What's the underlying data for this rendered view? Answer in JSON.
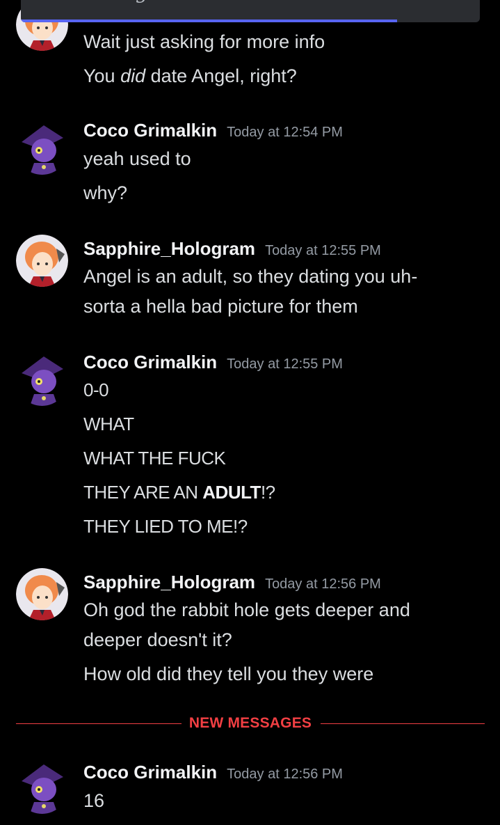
{
  "top_bar": {
    "text": "glare",
    "progress_fraction": 0.82
  },
  "colors": {
    "background": "#000000",
    "new_messages": "#f23f43",
    "accent": "#5865f2"
  },
  "groups": [
    {
      "avatar_icon": "sapphire-avatar-icon",
      "lines": [
        {
          "text": "Wait just asking for more info"
        }
      ]
    },
    {
      "lines": [
        {
          "pre": "You ",
          "em": "did",
          "post": " date Angel, right?"
        }
      ]
    },
    {
      "username": "Coco Grimalkin",
      "timestamp": "Today at 12:54 PM",
      "lines": [
        {
          "text": "yeah used to"
        },
        {
          "text": "why?"
        }
      ]
    },
    {
      "username": "Sapphire_Hologram",
      "timestamp": "Today at 12:55 PM",
      "lines": [
        {
          "text": "Angel is an adult, so they dating you uh-"
        },
        {
          "text": "sorta a hella bad picture for them"
        }
      ]
    },
    {
      "username": "Coco Grimalkin",
      "timestamp": "Today at 12:55 PM",
      "lines": [
        {
          "text": "0-0"
        },
        {
          "text": "WHAT"
        },
        {
          "text": "WHAT THE FUCK"
        },
        {
          "pre": "THEY ARE AN ",
          "bold": "ADULT",
          "post": "!?"
        },
        {
          "text": "THEY LIED TO ME!?"
        }
      ]
    },
    {
      "username": "Sapphire_Hologram",
      "timestamp": "Today at 12:56 PM",
      "lines": [
        {
          "text": "Oh god the rabbit hole gets deeper and"
        },
        {
          "text": "deeper doesn't it?"
        },
        {
          "text": "How old did they tell you they were"
        }
      ]
    },
    {
      "username": "Coco Grimalkin",
      "timestamp": "Today at 12:56 PM",
      "lines": [
        {
          "text": "16"
        }
      ]
    }
  ],
  "divider": {
    "label": "NEW MESSAGES"
  }
}
